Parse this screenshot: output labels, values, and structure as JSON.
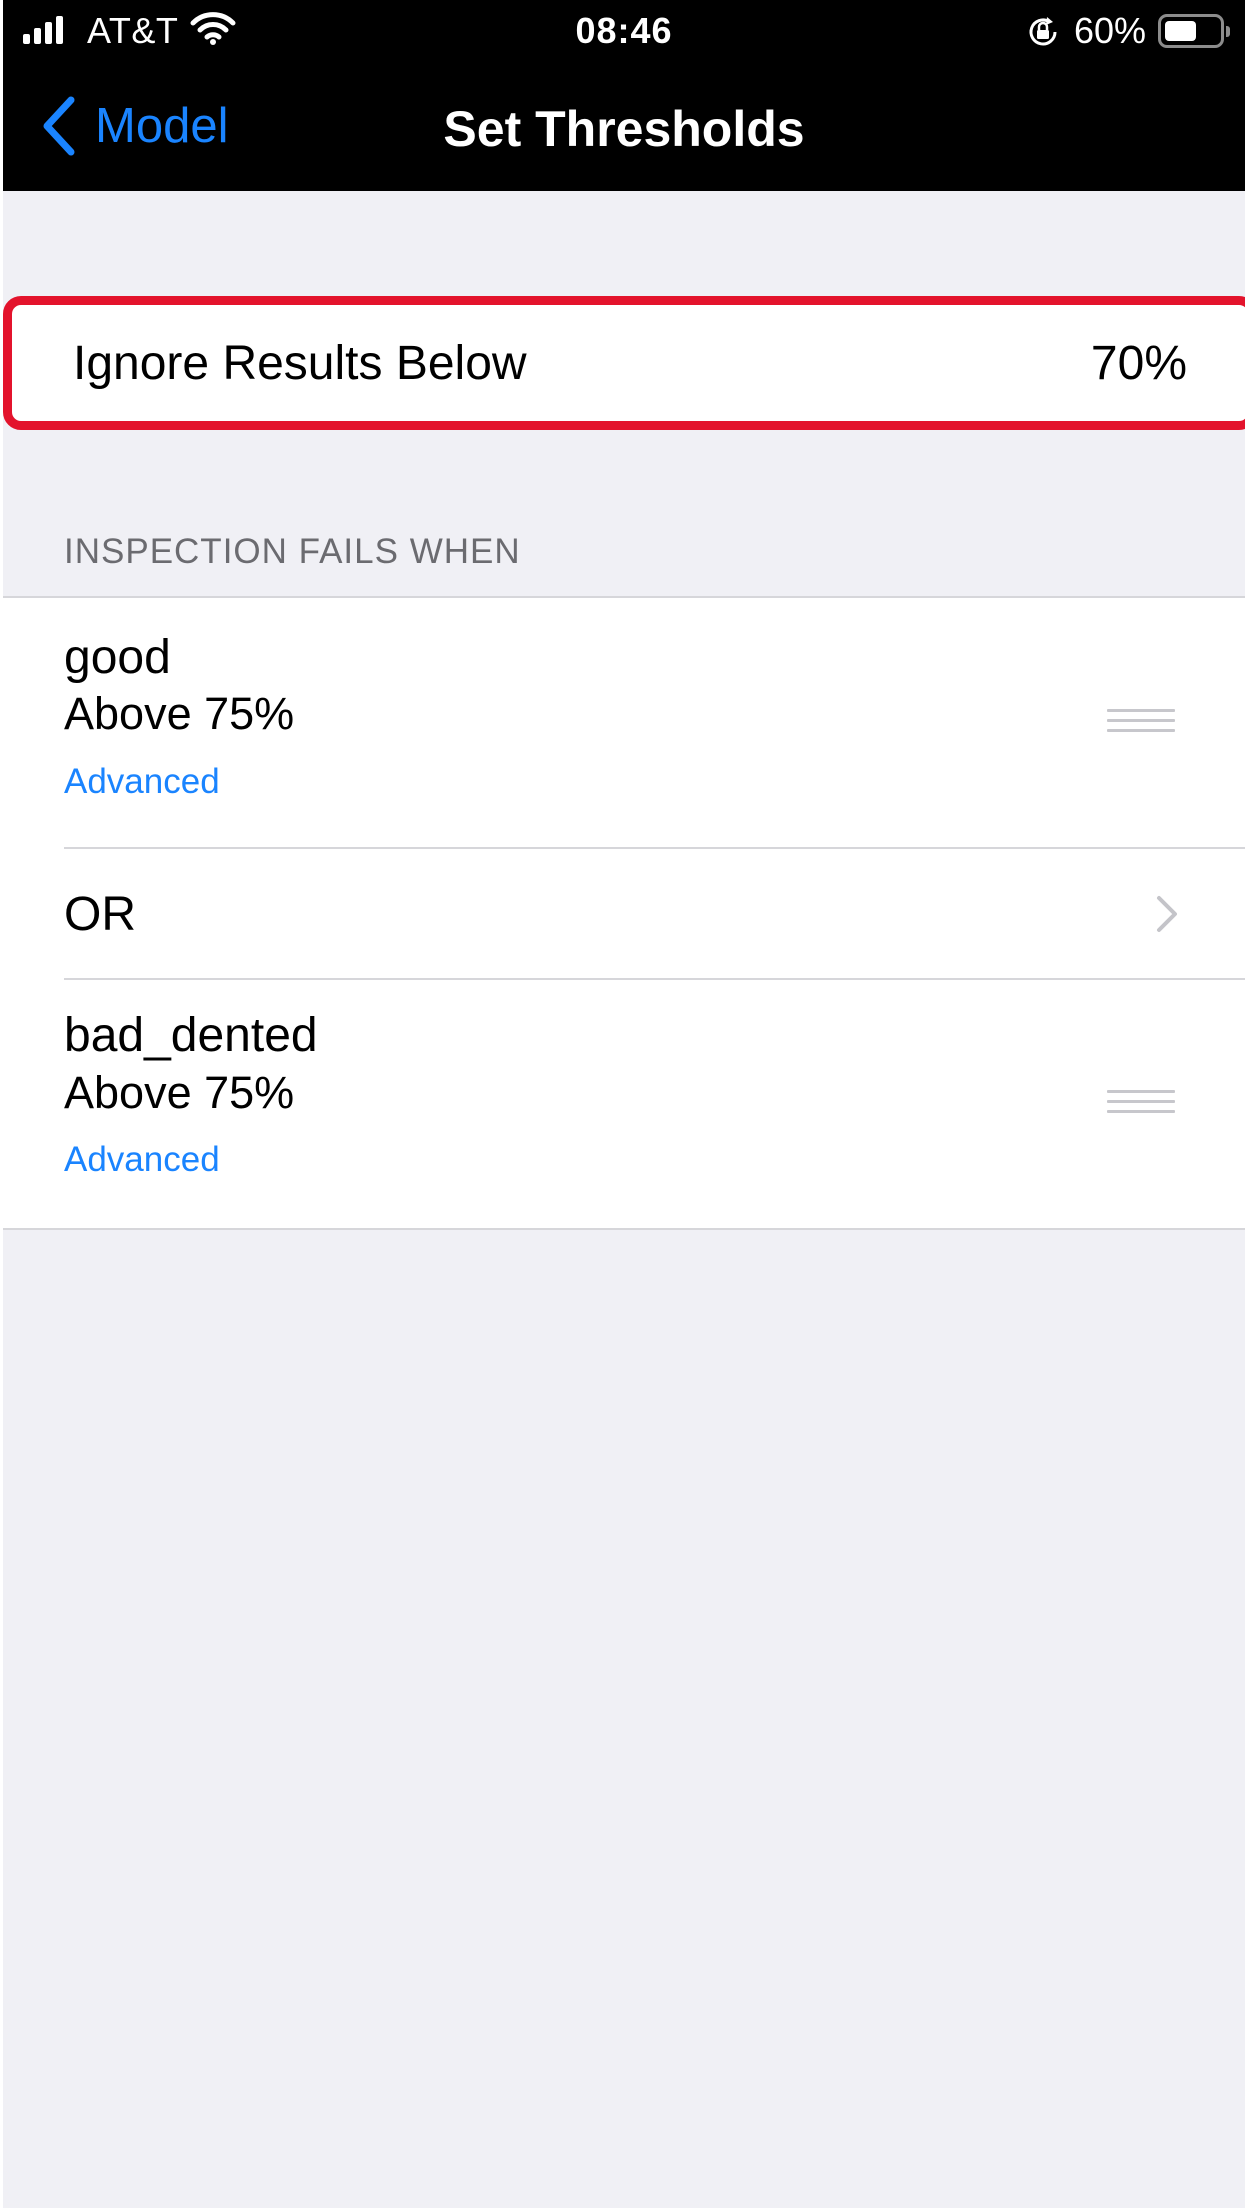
{
  "status_bar": {
    "carrier": "AT&T",
    "time": "08:46",
    "battery_percent": "60%",
    "battery_level": 0.6
  },
  "nav": {
    "back_label": "Model",
    "title": "Set Thresholds"
  },
  "threshold": {
    "label": "Ignore Results Below",
    "value": "70%"
  },
  "section": {
    "header": "INSPECTION FAILS WHEN"
  },
  "conditions": [
    {
      "name": "good",
      "condition": "Above 75%",
      "advanced_label": "Advanced"
    },
    {
      "name": "bad_dented",
      "condition": "Above 75%",
      "advanced_label": "Advanced"
    }
  ],
  "operator": {
    "label": "OR"
  },
  "colors": {
    "accent": "#1a84ff",
    "highlight": "#e3132c",
    "background": "#f0f0f5"
  }
}
